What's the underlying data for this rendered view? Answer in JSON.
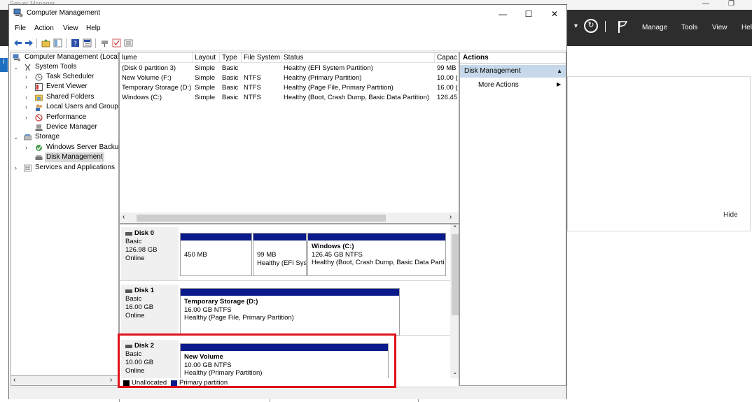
{
  "server_manager": {
    "title": "Server Manager",
    "minimize": "—",
    "restore": "❐",
    "menu": [
      "Manage",
      "Tools",
      "View",
      "Hel"
    ],
    "hide_label": "Hide",
    "sidebar_letter": "i"
  },
  "window": {
    "title": "Computer Management",
    "minimize": "—",
    "maximize": "☐",
    "close": "✕"
  },
  "menubar": [
    "File",
    "Action",
    "View",
    "Help"
  ],
  "tree": {
    "root": "Computer Management (Local",
    "system_tools": "System Tools",
    "task_scheduler": "Task Scheduler",
    "event_viewer": "Event Viewer",
    "shared_folders": "Shared Folders",
    "local_users": "Local Users and Groups",
    "performance": "Performance",
    "device_manager": "Device Manager",
    "storage": "Storage",
    "windows_server_backup": "Windows Server Backup",
    "disk_management": "Disk Management",
    "services_apps": "Services and Applications"
  },
  "volume_list": {
    "columns": [
      "lume",
      "Layout",
      "Type",
      "File System",
      "Status",
      "Capac"
    ],
    "rows": [
      [
        "(Disk 0 partition 3)",
        "Simple",
        "Basic",
        "",
        "Healthy (EFI System Partition)",
        "99 MB"
      ],
      [
        "New Volume (F:)",
        "Simple",
        "Basic",
        "NTFS",
        "Healthy (Primary Partition)",
        "10.00 ("
      ],
      [
        "Temporary Storage (D:)",
        "Simple",
        "Basic",
        "NTFS",
        "Healthy (Page File, Primary Partition)",
        "16.00 ("
      ],
      [
        "Windows (C:)",
        "Simple",
        "Basic",
        "NTFS",
        "Healthy (Boot, Crash Dump, Basic Data Partition)",
        "126.45"
      ]
    ]
  },
  "disks": {
    "disk0": {
      "name": "Disk 0",
      "type": "Basic",
      "size": "126.98 GB",
      "status": "Online",
      "p1": {
        "size": "450 MB"
      },
      "p2": {
        "size": "99 MB",
        "status": "Healthy (EFI Sys"
      },
      "p3": {
        "name": "Windows  (C:)",
        "size": "126.45 GB NTFS",
        "status": "Healthy (Boot, Crash Dump, Basic Data Parti"
      }
    },
    "disk1": {
      "name": "Disk 1",
      "type": "Basic",
      "size": "16.00 GB",
      "status": "Online",
      "p1": {
        "name": "Temporary Storage  (D:)",
        "size": "16.00 GB NTFS",
        "status": "Healthy (Page File, Primary Partition)"
      }
    },
    "disk2": {
      "name": "Disk 2",
      "type": "Basic",
      "size": "10.00 GB",
      "status": "Online",
      "p1": {
        "name": "New Volume",
        "size": "10.00 GB NTFS",
        "status": "Healthy (Primary Partition)"
      }
    }
  },
  "legend": {
    "unallocated": "Unallocated",
    "primary": "Primary partition"
  },
  "actions": {
    "header": "Actions",
    "section": "Disk Management",
    "more": "More Actions"
  },
  "colors": {
    "partition_bar": "#0a1a8a",
    "highlight": "#e0111a",
    "selected_action": "#c6d8ea"
  }
}
